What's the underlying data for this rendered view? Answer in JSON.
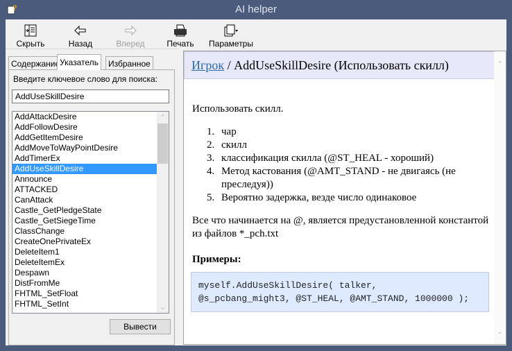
{
  "window": {
    "title": "AI helper"
  },
  "toolbar": {
    "hide": "Скрыть",
    "back": "Назад",
    "forward": "Вперед",
    "print": "Печать",
    "options": "Параметры"
  },
  "nav": {
    "tabs": [
      {
        "label": "Содержание"
      },
      {
        "label": "Указатель",
        "active": true
      },
      {
        "label": "Избранное"
      }
    ],
    "search_label": "Введите ключевое слово для поиска:",
    "search_value": "AddUseSkillDesire",
    "items": [
      "AddAttackDesire",
      "AddFollowDesire",
      "AddGetItemDesire",
      "AddMoveToWayPointDesire",
      "AddTimerEx",
      "AddUseSkillDesire",
      "Announce",
      "ATTACKED",
      "CanAttack",
      "Castle_GetPledgeState",
      "Castle_GetSiegeTime",
      "ClassChange",
      "CreateOnePrivateEx",
      "DeleteItem1",
      "DeleteItemEx",
      "Despawn",
      "DistFromMe",
      "FHTML_SetFloat",
      "FHTML_SetInt"
    ],
    "selected": "AddUseSkillDesire",
    "display_button": "Вывести"
  },
  "content": {
    "breadcrumb_link": "Игрок",
    "breadcrumb_sep": " / ",
    "title": "AddUseSkillDesire (Использовать скилл)",
    "intro": "Использовать скилл.",
    "params": [
      "чар",
      "скилл",
      "классификация скилла (@ST_HEAL - хороший)",
      "Метод кастования (@AMT_STAND - не двигаясь (не преследуя))",
      "Вероятно задержка, везде число одинаковое"
    ],
    "note": "Все что начинается на @, является предустановленной константой из файлов *_pch.txt",
    "examples_heading": "Примеры:",
    "code_line1": "myself.AddUseSkillDesire( talker,",
    "code_line2": "@s_pcbang_might3, @ST_HEAL, @AMT_STAND, 1000000 );"
  },
  "colors": {
    "frame": "#4b5b7c",
    "selection": "#3399ff",
    "header_bg": "#e8e8fb",
    "code_bg": "#ddeaff",
    "link": "#2a6aa8"
  }
}
